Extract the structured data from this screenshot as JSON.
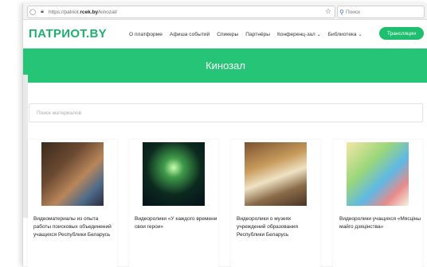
{
  "browser": {
    "url_prefix": "https://patriot.",
    "url_domain": "rcek.by",
    "url_path": "/kinozal/",
    "search_placeholder": "Поиск"
  },
  "header": {
    "logo": "ПАТРИОТ.BY",
    "nav": [
      "О платформе",
      "Афиша событий",
      "Спикеры",
      "Партнёры",
      "Конференц-зал",
      "Библиотека"
    ],
    "stream_button": "Трансляции"
  },
  "hero": {
    "title": "Кинозал"
  },
  "materials": {
    "search_placeholder": "Поиск материалов"
  },
  "cards": [
    {
      "caption": "Видеоматериалы из опыта работы поисковых объединений учащихся Республики Беларусь"
    },
    {
      "caption": "Видеоролики «У каждого времени свои герои»"
    },
    {
      "caption": "Видеоролики о музеях учреждений образования Республики Беларусь"
    },
    {
      "caption": "Видеоролики учащихся «Мясціны майго дзяцінства»"
    }
  ],
  "colors": {
    "brand_green": "#1db16e",
    "hero_green": "#26c476",
    "button_green": "#1fbf6f"
  }
}
